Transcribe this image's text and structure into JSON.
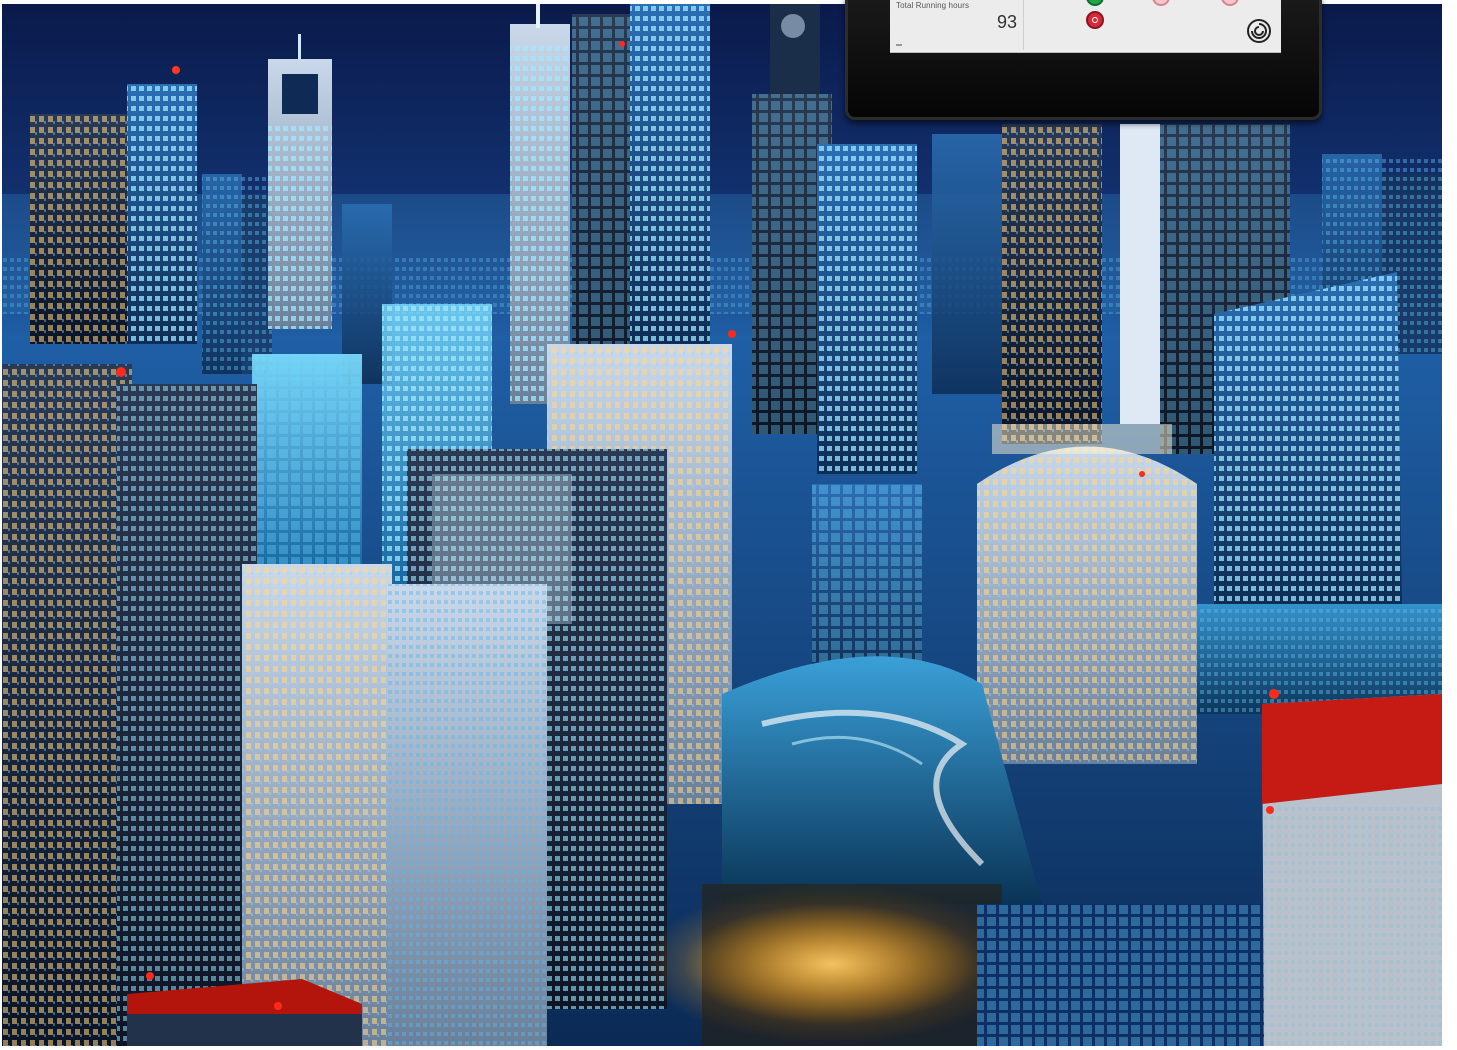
{
  "scene": {
    "description_colors": {
      "sky_top": "#0b1d4f",
      "sky_horizon": "#1f5fa6",
      "glow_cyan": "#38c8ff",
      "glow_warm": "#ffb347",
      "beacon_red": "#ff2a1a"
    }
  },
  "hmi": {
    "reading_label": "Total Running hours",
    "reading_value": "93",
    "buttons": [
      {
        "name": "start",
        "color": "#1fa54a"
      },
      {
        "name": "stop",
        "color": "#d42a3a"
      },
      {
        "name": "indicator-1",
        "color": "#f3c7cc"
      },
      {
        "name": "indicator-2",
        "color": "#f3c7cc"
      }
    ],
    "icon": "spiral-logo-icon"
  }
}
